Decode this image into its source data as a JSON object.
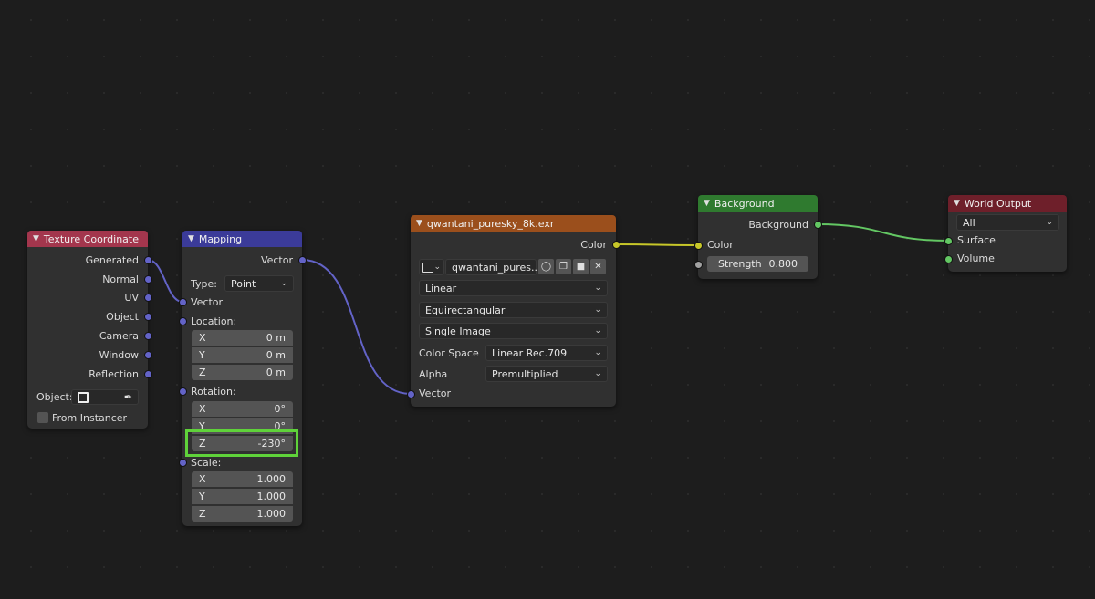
{
  "colors": {
    "background": "#1d1d1d",
    "node_body": "#303030",
    "texture_coordinate_header": "#a3364d",
    "mapping_header": "#3b3b99",
    "image_texture_header": "#9b4f1c",
    "background_header": "#2f7a2f",
    "world_output_header": "#6e1f2a",
    "vector_socket": "#6363c7",
    "color_socket": "#c7c729",
    "shader_socket": "#63c763",
    "float_socket": "#a1a1a1",
    "highlight": "#5fd23a"
  },
  "texture_coordinate": {
    "title": "Texture Coordinate",
    "outputs": [
      "Generated",
      "Normal",
      "UV",
      "Object",
      "Camera",
      "Window",
      "Reflection"
    ],
    "object_label": "Object:",
    "from_instancer_label": "From Instancer"
  },
  "mapping": {
    "title": "Mapping",
    "output": "Vector",
    "type_label": "Type:",
    "type_value": "Point",
    "vector_input": "Vector",
    "location_label": "Location:",
    "location": [
      {
        "axis": "X",
        "value": "0 m"
      },
      {
        "axis": "Y",
        "value": "0 m"
      },
      {
        "axis": "Z",
        "value": "0 m"
      }
    ],
    "rotation_label": "Rotation:",
    "rotation": [
      {
        "axis": "X",
        "value": "0°"
      },
      {
        "axis": "Y",
        "value": "0°"
      },
      {
        "axis": "Z",
        "value": "-230°"
      }
    ],
    "scale_label": "Scale:",
    "scale": [
      {
        "axis": "X",
        "value": "1.000"
      },
      {
        "axis": "Y",
        "value": "1.000"
      },
      {
        "axis": "Z",
        "value": "1.000"
      }
    ]
  },
  "image_texture": {
    "title": "qwantani_puresky_8k.exr",
    "output": "Color",
    "image_name": "qwantani_pures...",
    "interpolation": "Linear",
    "projection": "Equirectangular",
    "source": "Single Image",
    "color_space_label": "Color Space",
    "color_space_value": "Linear Rec.709",
    "alpha_label": "Alpha",
    "alpha_value": "Premultiplied",
    "vector_input": "Vector"
  },
  "background_node": {
    "title": "Background",
    "output": "Background",
    "color_input": "Color",
    "strength_label": "Strength",
    "strength_value": "0.800"
  },
  "world_output": {
    "title": "World Output",
    "target": "All",
    "surface_input": "Surface",
    "volume_input": "Volume"
  },
  "icons": [
    "chevron-down-icon",
    "image-icon",
    "shield-icon",
    "duplicate-icon",
    "folder-icon",
    "close-icon",
    "eyedropper-icon",
    "object-icon"
  ]
}
